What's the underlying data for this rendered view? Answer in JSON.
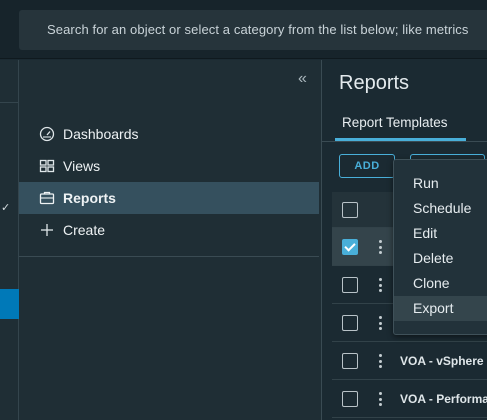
{
  "search": {
    "placeholder": "Search for an object or select a category from the list below; like metrics"
  },
  "nav": {
    "items": [
      {
        "label": "Dashboards",
        "icon": "dashboard-icon"
      },
      {
        "label": "Views",
        "icon": "views-icon"
      },
      {
        "label": "Reports",
        "icon": "reports-icon",
        "active": true
      },
      {
        "label": "Create",
        "icon": "plus-icon"
      }
    ],
    "collapse_glyph": "«"
  },
  "main": {
    "title": "Reports",
    "tab": "Report Templates",
    "add_label": "ADD",
    "rows": [
      {
        "name": "",
        "checked": true
      },
      {
        "name": "",
        "checked": false
      },
      {
        "name": "",
        "checked": false
      },
      {
        "name": "VOA - vSphere",
        "checked": false
      },
      {
        "name": "VOA - Performa",
        "checked": false
      }
    ]
  },
  "menu": {
    "items": [
      "Run",
      "Schedule",
      "Edit",
      "Delete",
      "Clone",
      "Export"
    ],
    "hovered": "Export"
  },
  "colors": {
    "accent": "#49afd9",
    "active_nav": "#35505e",
    "brand_blue": "#0079b8"
  }
}
